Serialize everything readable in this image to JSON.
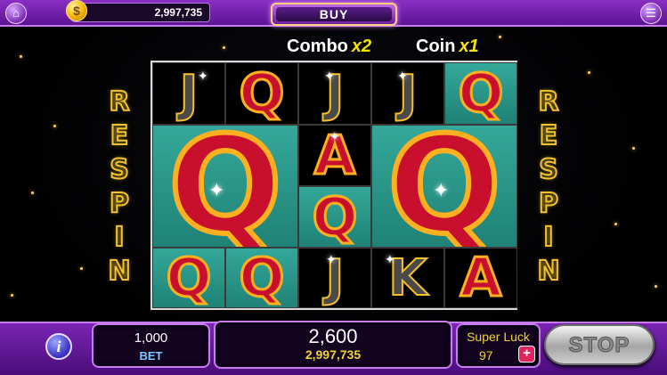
{
  "header": {
    "coin_balance": "2,997,735",
    "coin_symbol": "$",
    "buy_label": "BUY",
    "home_icon": "home-icon",
    "menu_icon": "menu-icon"
  },
  "multipliers": {
    "combo_label": "Combo",
    "combo_value": "x2",
    "coin_label": "Coin",
    "coin_value": "x1"
  },
  "side_banner": [
    "R",
    "E",
    "S",
    "P",
    "I",
    "N"
  ],
  "reels": {
    "symbols": [
      {
        "cell": "r1c1",
        "glyph": "J",
        "style": "gold"
      },
      {
        "cell": "r1c2",
        "glyph": "Q",
        "style": "red"
      },
      {
        "cell": "r1c3",
        "glyph": "J",
        "style": "gold"
      },
      {
        "cell": "r1c4",
        "glyph": "J",
        "style": "gold"
      },
      {
        "cell": "r1c5",
        "glyph": "Q",
        "style": "red"
      },
      {
        "cell": "big-left",
        "glyph": "Q",
        "style": "red"
      },
      {
        "cell": "r2c3",
        "glyph": "A",
        "style": "red"
      },
      {
        "cell": "r3c3",
        "glyph": "Q",
        "style": "red"
      },
      {
        "cell": "big-right",
        "glyph": "Q",
        "style": "red"
      },
      {
        "cell": "r4c1",
        "glyph": "Q",
        "style": "red"
      },
      {
        "cell": "r4c2",
        "glyph": "Q",
        "style": "red"
      },
      {
        "cell": "r4c3",
        "glyph": "J",
        "style": "gold"
      },
      {
        "cell": "r4c4",
        "glyph": "K",
        "style": "gold"
      },
      {
        "cell": "r4c5",
        "glyph": "A",
        "style": "red"
      }
    ]
  },
  "footer": {
    "bet_value": "1,000",
    "bet_label": "BET",
    "win_value": "2,600",
    "win_total": "2,997,735",
    "luck_label": "Super Luck",
    "luck_value": "97",
    "luck_plus": "+",
    "info_glyph": "i",
    "stop_label": "STOP"
  }
}
